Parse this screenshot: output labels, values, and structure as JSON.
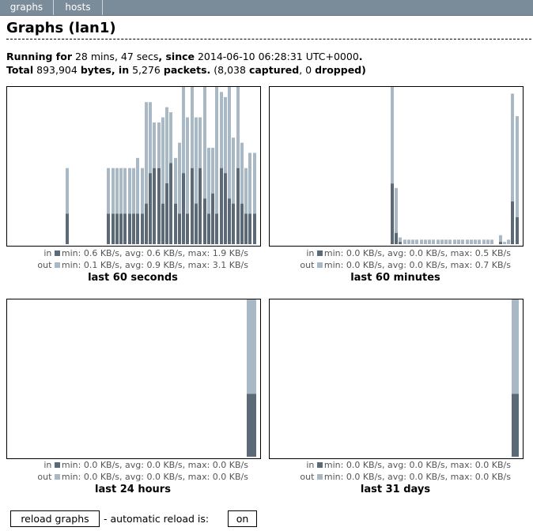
{
  "nav": {
    "tabs": [
      {
        "label": "graphs"
      },
      {
        "label": "hosts"
      }
    ]
  },
  "page": {
    "title": "Graphs (lan1)",
    "running_label": "Running for",
    "running_value": "28 mins, 47 secs",
    "since_label": ", since",
    "since_value": "2014-06-10 06:28:31 UTC+0000",
    "since_end": ".",
    "total_label": "Total",
    "total_bytes": "893,904",
    "bytes_label": "bytes, in",
    "total_packets": "5,276",
    "packets_label": "packets.",
    "captured_open": "(8,038",
    "captured_label": "captured",
    "dropped_sep": ", 0",
    "dropped_label": "dropped)"
  },
  "colors": {
    "in": "#5b6a76",
    "out": "#a9b8c5"
  },
  "graphs": [
    {
      "caption": "last 60 seconds",
      "in_stats": "min: 0.6 KB/s, avg: 0.6 KB/s, max: 1.9 KB/s",
      "out_stats": "min: 0.1 KB/s, avg: 0.9 KB/s, max: 3.1 KB/s",
      "in_label": "in",
      "out_label": "out",
      "chart_data": {
        "type": "bar",
        "slots": 60,
        "in": [
          0,
          0,
          0,
          0,
          0,
          0,
          0,
          0,
          0,
          0,
          0,
          0,
          0,
          0,
          0.6,
          0,
          0,
          0,
          0,
          0,
          0,
          0,
          0,
          0,
          0.6,
          0.6,
          0.6,
          0.6,
          0.6,
          0.6,
          0.6,
          0.6,
          0.6,
          0.8,
          1.4,
          1.5,
          1.5,
          0.8,
          1.2,
          1.6,
          0.8,
          0.6,
          1.4,
          0.6,
          1.5,
          0.8,
          1.5,
          0.9,
          0.6,
          1.0,
          0.6,
          1.5,
          1.4,
          0.9,
          0.8,
          1.5,
          0.8,
          0.6,
          0.6,
          0.6
        ],
        "out": [
          0,
          0,
          0,
          0,
          0,
          0,
          0,
          0,
          0,
          0,
          0,
          0,
          0,
          0,
          0.9,
          0,
          0,
          0,
          0,
          0,
          0,
          0,
          0,
          0,
          0.9,
          0.9,
          0.9,
          0.9,
          0.9,
          0.9,
          0.9,
          1.1,
          0.9,
          2.0,
          1.4,
          0.9,
          0.9,
          1.7,
          1.5,
          1.0,
          0.9,
          1.4,
          2.0,
          1.9,
          1.6,
          1.7,
          1.0,
          2.4,
          1.3,
          0.9,
          2.6,
          1.5,
          1.5,
          2.7,
          1.3,
          2.7,
          1.2,
          0.9,
          1.2,
          1.2
        ],
        "ylim": [
          0,
          3.1
        ]
      }
    },
    {
      "caption": "last 60 minutes",
      "in_stats": "min: 0.0 KB/s, avg: 0.0 KB/s, max: 0.5 KB/s",
      "out_stats": "min: 0.0 KB/s, avg: 0.0 KB/s, max: 0.7 KB/s",
      "in_label": "in",
      "out_label": "out",
      "chart_data": {
        "type": "bar",
        "slots": 60,
        "in": [
          0,
          0,
          0,
          0,
          0,
          0,
          0,
          0,
          0,
          0,
          0,
          0,
          0,
          0,
          0,
          0,
          0,
          0,
          0,
          0,
          0,
          0,
          0,
          0,
          0,
          0,
          0,
          0,
          0,
          0.27,
          0.05,
          0.01,
          0,
          0,
          0,
          0,
          0,
          0,
          0,
          0,
          0,
          0,
          0,
          0,
          0,
          0,
          0,
          0,
          0,
          0,
          0,
          0,
          0,
          0,
          0,
          0.01,
          0,
          0,
          0.19,
          0.12
        ],
        "out": [
          0,
          0,
          0,
          0,
          0,
          0,
          0,
          0,
          0,
          0,
          0,
          0,
          0,
          0,
          0,
          0,
          0,
          0,
          0,
          0,
          0,
          0,
          0,
          0,
          0,
          0,
          0,
          0,
          0,
          0.7,
          0.2,
          0.02,
          0.02,
          0.02,
          0.02,
          0.02,
          0.02,
          0.02,
          0.02,
          0.02,
          0.02,
          0.02,
          0.02,
          0.02,
          0.02,
          0.02,
          0.02,
          0.02,
          0.02,
          0.02,
          0.02,
          0.02,
          0.02,
          0.02,
          0,
          0.03,
          0.01,
          0.02,
          0.48,
          0.45
        ],
        "ylim": [
          0,
          0.7
        ]
      }
    },
    {
      "caption": "last 24 hours",
      "in_stats": "min: 0.0 KB/s, avg: 0.0 KB/s, max: 0.0 KB/s",
      "out_stats": "min: 0.0 KB/s, avg: 0.0 KB/s, max: 0.0 KB/s",
      "in_label": "in",
      "out_label": "out",
      "chart_data": {
        "type": "bar",
        "slots": 24,
        "in": [
          0,
          0,
          0,
          0,
          0,
          0,
          0,
          0,
          0,
          0,
          0,
          0,
          0,
          0,
          0,
          0,
          0,
          0,
          0,
          0,
          0,
          0,
          0,
          0.4
        ],
        "out": [
          0,
          0,
          0,
          0,
          0,
          0,
          0,
          0,
          0,
          0,
          0,
          0,
          0,
          0,
          0,
          0,
          0,
          0,
          0,
          0,
          0,
          0,
          0,
          0.6
        ],
        "ylim": [
          0,
          1
        ]
      }
    },
    {
      "caption": "last 31 days",
      "in_stats": "min: 0.0 KB/s, avg: 0.0 KB/s, max: 0.0 KB/s",
      "out_stats": "min: 0.0 KB/s, avg: 0.0 KB/s, max: 0.0 KB/s",
      "in_label": "in",
      "out_label": "out",
      "chart_data": {
        "type": "bar",
        "slots": 31,
        "in": [
          0,
          0,
          0,
          0,
          0,
          0,
          0,
          0,
          0,
          0,
          0,
          0,
          0,
          0,
          0,
          0,
          0,
          0,
          0,
          0,
          0,
          0,
          0,
          0,
          0,
          0,
          0,
          0,
          0,
          0,
          0.4
        ],
        "out": [
          0,
          0,
          0,
          0,
          0,
          0,
          0,
          0,
          0,
          0,
          0,
          0,
          0,
          0,
          0,
          0,
          0,
          0,
          0,
          0,
          0,
          0,
          0,
          0,
          0,
          0,
          0,
          0,
          0,
          0,
          0.6
        ],
        "ylim": [
          0,
          1
        ]
      }
    }
  ],
  "footer": {
    "reload_label": "reload graphs",
    "autoreload_text": "- automatic reload is:",
    "autoreload_state": "on"
  }
}
